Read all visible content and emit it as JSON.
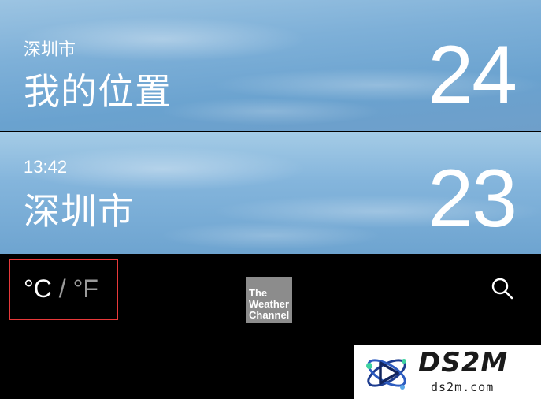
{
  "locations": [
    {
      "subtitle": "深圳市",
      "name": "我的位置",
      "temperature": "24"
    },
    {
      "subtitle": "13:42",
      "name": "深圳市",
      "temperature": "23"
    }
  ],
  "toolbar": {
    "unit_celsius": "°C",
    "unit_separator": " / ",
    "unit_fahrenheit": "°F",
    "logo_line1": "The",
    "logo_line2": "Weather",
    "logo_line3": "Channel",
    "search_icon": "search-icon",
    "highlight_color": "#e8393a"
  },
  "watermark": {
    "title": "DS2M",
    "subtitle": "ds2m.com"
  }
}
